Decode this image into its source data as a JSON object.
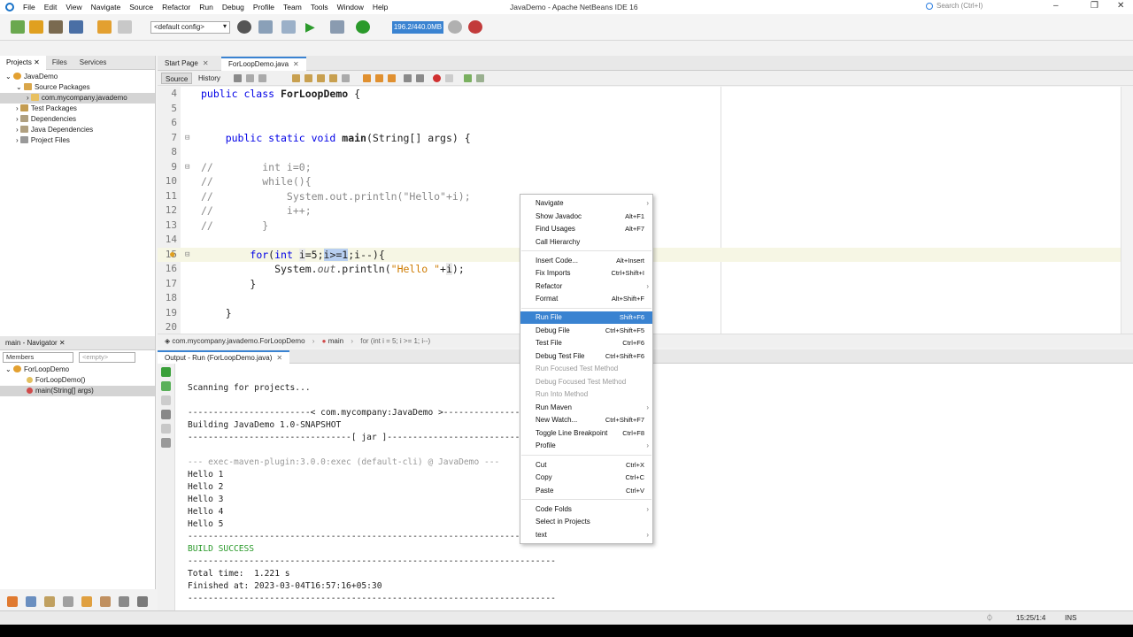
{
  "window": {
    "title": "JavaDemo - Apache NetBeans IDE 16",
    "search_placeholder": "Search (Ctrl+I)",
    "minimize": "–",
    "maximize": "❐",
    "close": "✕"
  },
  "menu": [
    "File",
    "Edit",
    "View",
    "Navigate",
    "Source",
    "Refactor",
    "Run",
    "Debug",
    "Profile",
    "Team",
    "Tools",
    "Window",
    "Help"
  ],
  "toolbar": {
    "config": "<default config>",
    "memory": "196.2/440.0MB"
  },
  "projects_panel": {
    "tabs": [
      "Projects",
      "Files",
      "Services"
    ],
    "tree": [
      {
        "label": "JavaDemo"
      },
      {
        "label": "Source Packages"
      },
      {
        "label": "com.mycompany.javademo"
      },
      {
        "label": "Test Packages"
      },
      {
        "label": "Dependencies"
      },
      {
        "label": "Java Dependencies"
      },
      {
        "label": "Project Files"
      }
    ]
  },
  "navigator": {
    "title": "main - Navigator",
    "members_label": "Members",
    "filter": "<empty>",
    "tree": [
      {
        "label": "ForLoopDemo"
      },
      {
        "label": "ForLoopDemo()"
      },
      {
        "label": "main(String[] args)"
      }
    ]
  },
  "editor": {
    "tabs": [
      "Start Page",
      "ForLoopDemo.java"
    ],
    "source_label": "Source",
    "history_label": "History",
    "lines": [
      {
        "n": "4",
        "text": "public class ForLoopDemo {"
      },
      {
        "n": "5",
        "text": ""
      },
      {
        "n": "6",
        "text": ""
      },
      {
        "n": "7",
        "text": "    public static void main(String[] args) {"
      },
      {
        "n": "8",
        "text": ""
      },
      {
        "n": "9",
        "text": "//        int i=0;"
      },
      {
        "n": "10",
        "text": "//        while(){"
      },
      {
        "n": "11",
        "text": "//            System.out.println(\"Hello\"+i);"
      },
      {
        "n": "12",
        "text": "//            i++;"
      },
      {
        "n": "13",
        "text": "//        }"
      },
      {
        "n": "14",
        "text": ""
      },
      {
        "n": "15",
        "text": "        for(int i=5;i>=1;i--){"
      },
      {
        "n": "16",
        "text": "            System.out.println(\"Hello \"+i);"
      },
      {
        "n": "17",
        "text": "        }"
      },
      {
        "n": "18",
        "text": ""
      },
      {
        "n": "19",
        "text": "    }"
      },
      {
        "n": "20",
        "text": ""
      }
    ],
    "breadcrumb": [
      "com.mycompany.javademo.ForLoopDemo",
      "main",
      "for (int i = 5; i >= 1; i--)"
    ]
  },
  "output": {
    "tab": "Output - Run (ForLoopDemo.java)",
    "lines": [
      "Scanning for projects...",
      "",
      "------------------------< com.mycompany:JavaDemo >------------------------",
      "Building JavaDemo 1.0-SNAPSHOT",
      "--------------------------------[ jar ]---------------------------------",
      "",
      "--- exec-maven-plugin:3.0.0:exec (default-cli) @ JavaDemo ---",
      "Hello 1",
      "Hello 2",
      "Hello 3",
      "Hello 4",
      "Hello 5",
      "------------------------------------------------------------------------",
      "BUILD SUCCESS",
      "------------------------------------------------------------------------",
      "Total time:  1.221 s",
      "Finished at: 2023-03-04T16:57:16+05:30",
      "------------------------------------------------------------------------"
    ]
  },
  "context_menu": {
    "items": [
      {
        "label": "Navigate",
        "shortcut": "",
        "submenu": true
      },
      {
        "label": "Show Javadoc",
        "shortcut": "Alt+F1"
      },
      {
        "label": "Find Usages",
        "shortcut": "Alt+F7"
      },
      {
        "label": "Call Hierarchy",
        "shortcut": ""
      },
      {
        "label": "Insert Code...",
        "shortcut": "Alt+Insert"
      },
      {
        "label": "Fix Imports",
        "shortcut": "Ctrl+Shift+I"
      },
      {
        "label": "Refactor",
        "shortcut": "",
        "submenu": true
      },
      {
        "label": "Format",
        "shortcut": "Alt+Shift+F"
      },
      {
        "label": "Run File",
        "shortcut": "Shift+F6"
      },
      {
        "label": "Debug File",
        "shortcut": "Ctrl+Shift+F5"
      },
      {
        "label": "Test File",
        "shortcut": "Ctrl+F6"
      },
      {
        "label": "Debug Test File",
        "shortcut": "Ctrl+Shift+F6"
      },
      {
        "label": "Run Focused Test Method",
        "shortcut": ""
      },
      {
        "label": "Debug Focused Test Method",
        "shortcut": ""
      },
      {
        "label": "Run Into Method",
        "shortcut": ""
      },
      {
        "label": "Run Maven",
        "shortcut": "",
        "submenu": true
      },
      {
        "label": "New Watch...",
        "shortcut": "Ctrl+Shift+F7"
      },
      {
        "label": "Toggle Line Breakpoint",
        "shortcut": "Ctrl+F8"
      },
      {
        "label": "Profile",
        "shortcut": "",
        "submenu": true
      },
      {
        "label": "Cut",
        "shortcut": "Ctrl+X"
      },
      {
        "label": "Copy",
        "shortcut": "Ctrl+C"
      },
      {
        "label": "Paste",
        "shortcut": "Ctrl+V"
      },
      {
        "label": "Code Folds",
        "shortcut": "",
        "submenu": true
      },
      {
        "label": "Select in Projects",
        "shortcut": ""
      },
      {
        "label": "text",
        "shortcut": "",
        "submenu": true
      }
    ]
  },
  "status": {
    "position": "15:25/1:4",
    "mode": "INS"
  },
  "colors": {
    "accent": "#3a83d1",
    "keyword": "#0000e6",
    "comment": "#8a8a8a",
    "success": "#2a9a2a"
  }
}
